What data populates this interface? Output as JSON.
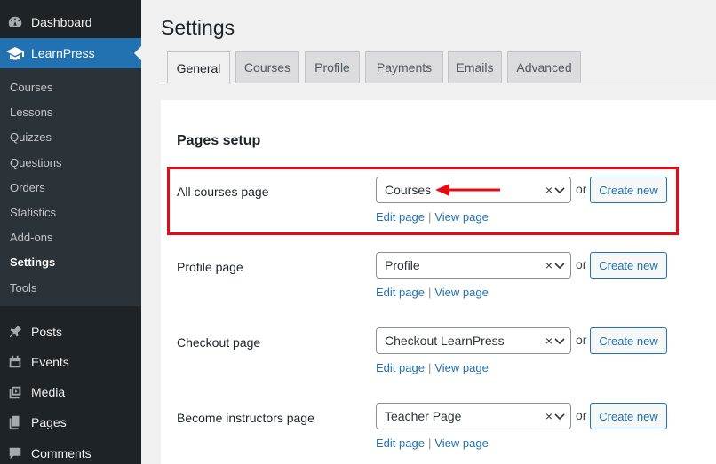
{
  "sidebar": {
    "top_items": [
      {
        "label": "Dashboard",
        "icon": "dashboard-icon"
      },
      {
        "label": "LearnPress",
        "icon": "graduation-cap-icon"
      }
    ],
    "submenu": [
      "Courses",
      "Lessons",
      "Quizzes",
      "Questions",
      "Orders",
      "Statistics",
      "Add-ons",
      "Settings",
      "Tools"
    ],
    "bottom_items": [
      {
        "label": "Posts",
        "icon": "pin-icon"
      },
      {
        "label": "Events",
        "icon": "calendar-icon"
      },
      {
        "label": "Media",
        "icon": "media-icon"
      },
      {
        "label": "Pages",
        "icon": "pages-icon"
      },
      {
        "label": "Comments",
        "icon": "comment-icon"
      }
    ],
    "active_color": "#2271b1"
  },
  "page": {
    "title": "Settings",
    "tabs": [
      "General",
      "Courses",
      "Profile",
      "Payments",
      "Emails",
      "Advanced"
    ],
    "active_tab": "General"
  },
  "section": {
    "title": "Pages setup",
    "rows": [
      {
        "label": "All courses page",
        "selected": "Courses",
        "clear": "×",
        "or": "or",
        "button": "Create new",
        "edit": "Edit page",
        "sep": "|",
        "view": "View page"
      },
      {
        "label": "Profile page",
        "selected": "Profile",
        "clear": "×",
        "or": "or",
        "button": "Create new",
        "edit": "Edit page",
        "sep": "|",
        "view": "View page"
      },
      {
        "label": "Checkout page",
        "selected": "Checkout LearnPress",
        "clear": "×",
        "or": "or",
        "button": "Create new",
        "edit": "Edit page",
        "sep": "|",
        "view": "View page"
      },
      {
        "label": "Become instructors page",
        "selected": "Teacher Page",
        "clear": "×",
        "or": "or",
        "button": "Create new",
        "edit": "Edit page",
        "sep": "|",
        "view": "View page"
      }
    ]
  },
  "annotation": {
    "color": "#e50914"
  }
}
